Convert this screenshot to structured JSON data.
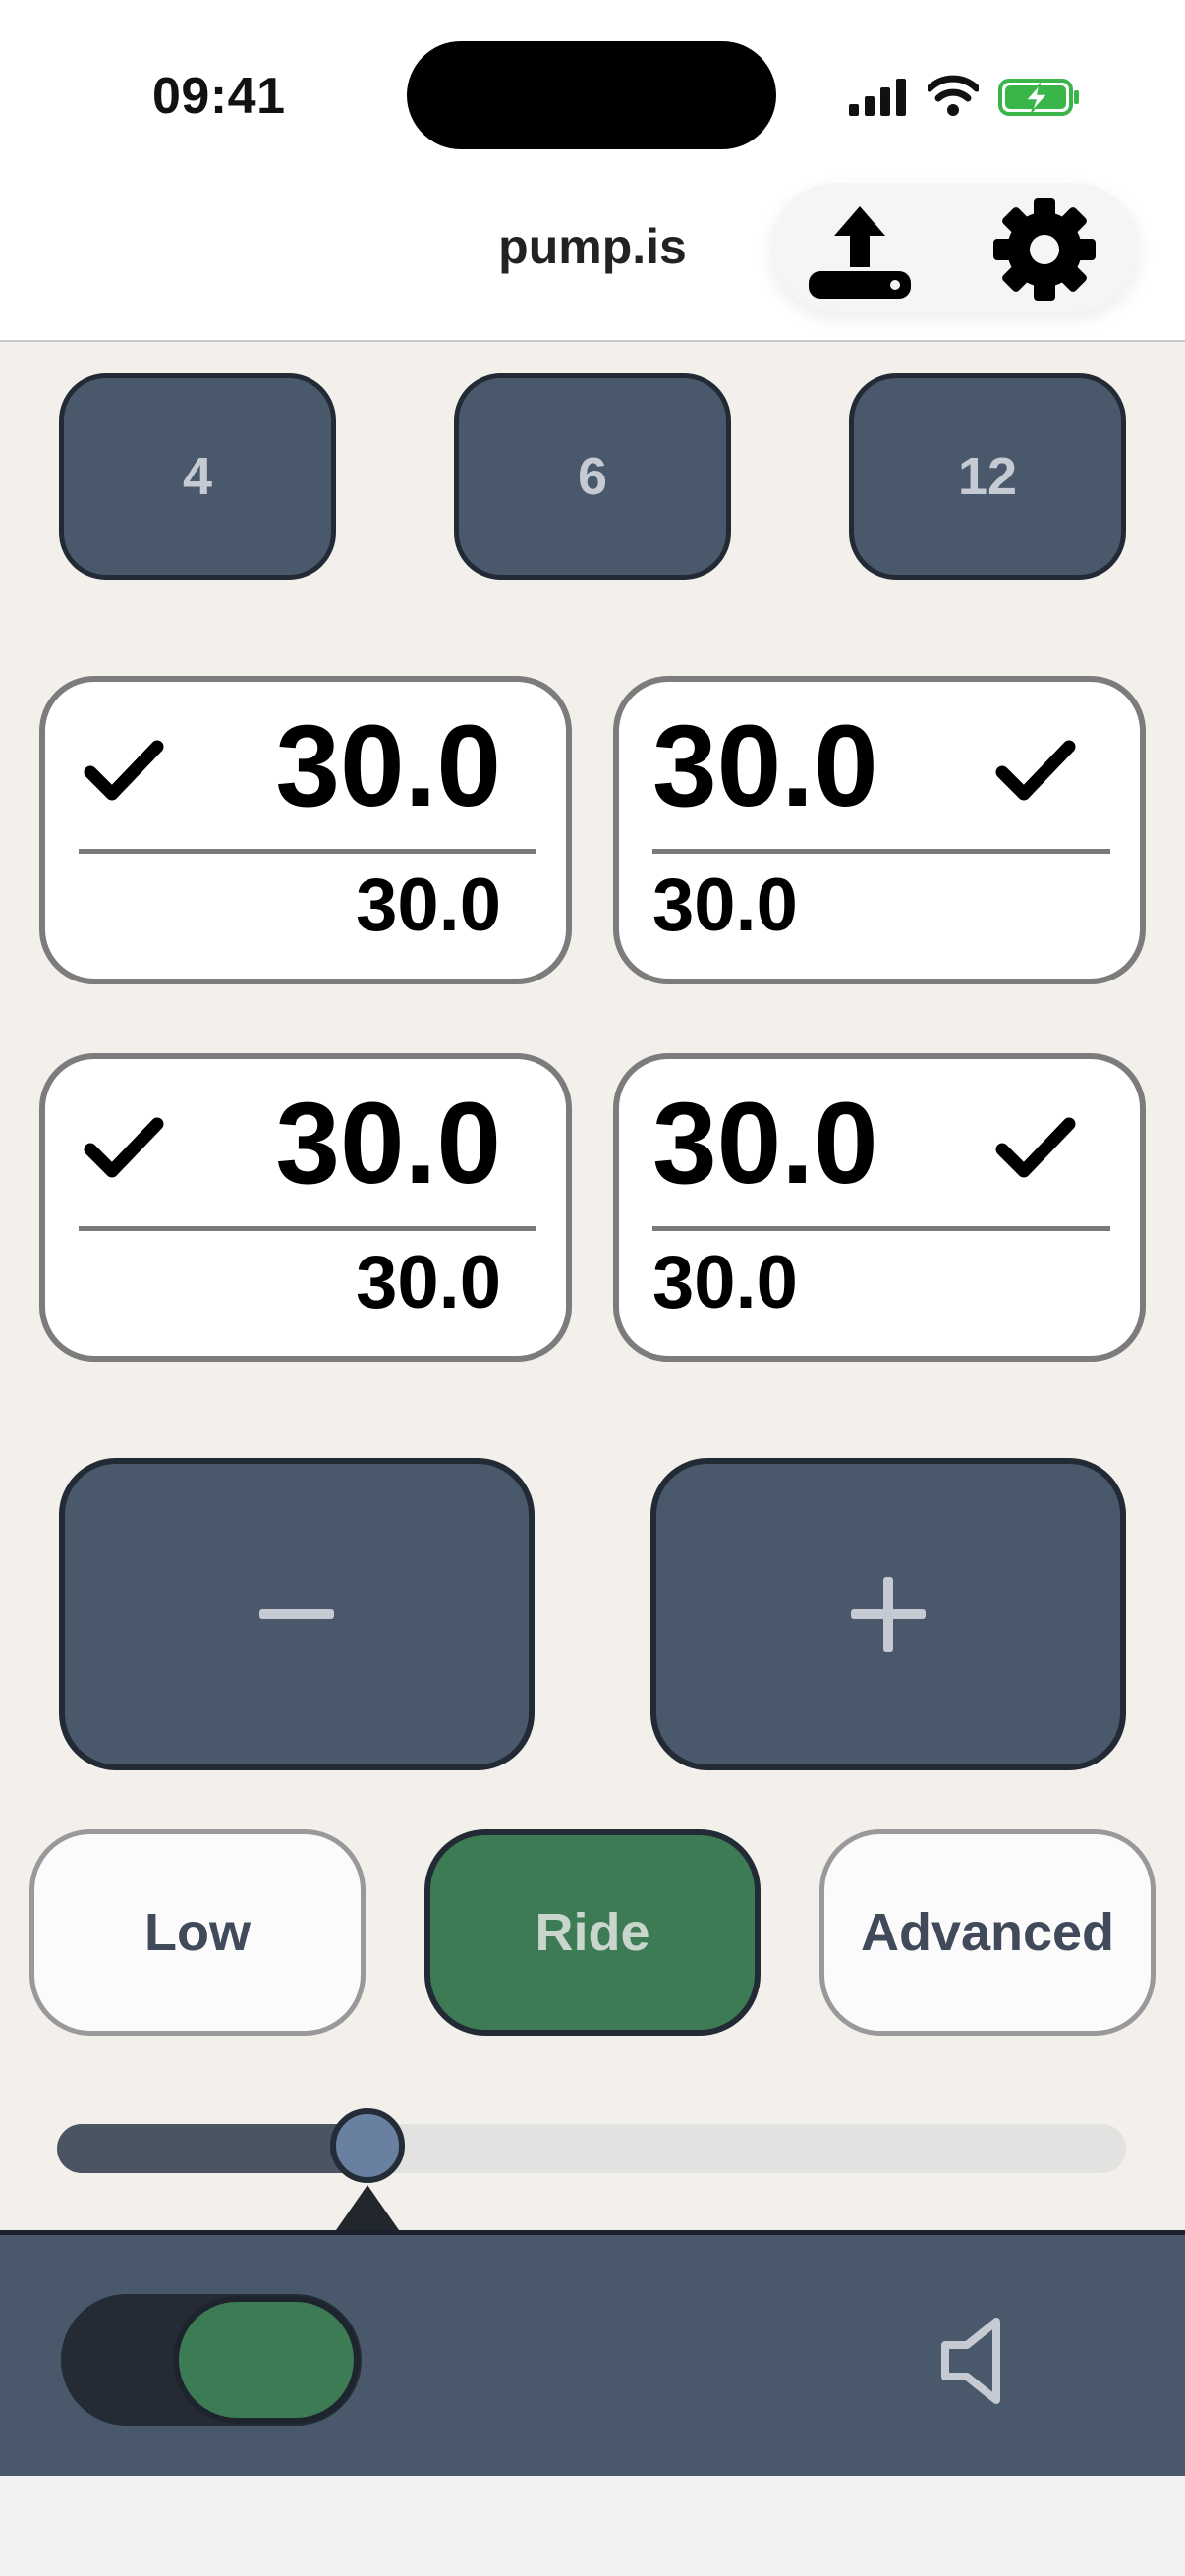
{
  "status_bar": {
    "time": "09:41",
    "icons": [
      "signal-icon",
      "wifi-icon",
      "battery-charging-icon"
    ]
  },
  "header": {
    "title": "pump.is",
    "actions": [
      "upload-icon",
      "gear-icon"
    ]
  },
  "presets": [
    {
      "label": "4"
    },
    {
      "label": "6"
    },
    {
      "label": "12"
    }
  ],
  "readings": [
    {
      "big": "30.0",
      "small": "30.0",
      "checked": true
    },
    {
      "big": "30.0",
      "small": "30.0",
      "checked": true
    },
    {
      "big": "30.0",
      "small": "30.0",
      "checked": true
    },
    {
      "big": "30.0",
      "small": "30.0",
      "checked": true
    }
  ],
  "controls": {
    "decrement_icon": "minus-icon",
    "increment_icon": "plus-icon"
  },
  "modes": [
    {
      "label": "Low",
      "active": false
    },
    {
      "label": "Ride",
      "active": true
    },
    {
      "label": "Advanced",
      "active": false
    }
  ],
  "slider": {
    "level_fraction": 0.29
  },
  "bottom": {
    "toggle_on": true,
    "sound_icon": "speaker-icon"
  },
  "colors": {
    "button_slate": "#4a586b",
    "active_green": "#3d7b54",
    "main_background": "#f3f0eb",
    "card_border": "#7c7c7c"
  }
}
